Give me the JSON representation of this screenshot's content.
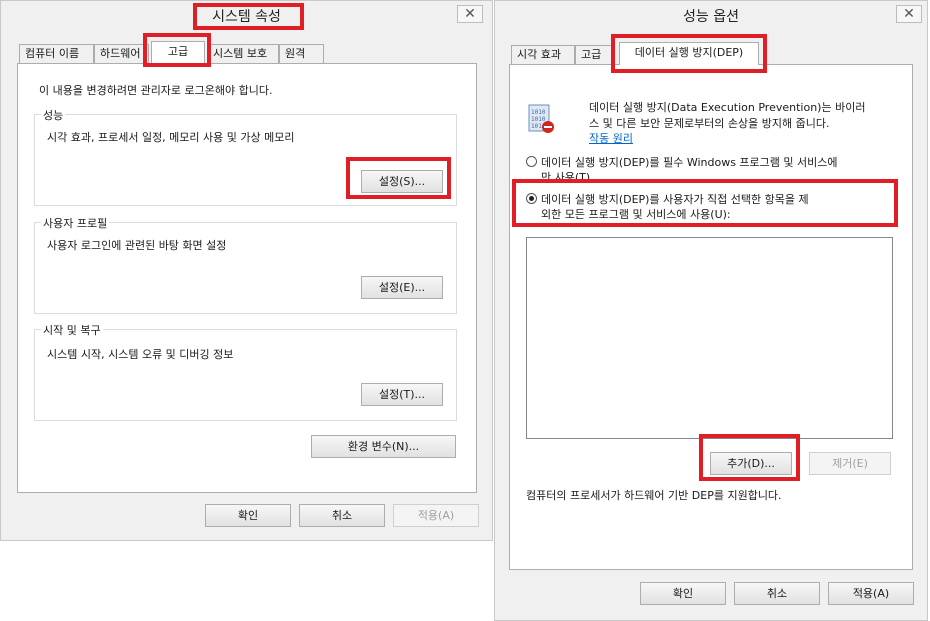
{
  "left_window": {
    "title": "시스템 속성",
    "close_glyph": "✕",
    "tabs": [
      {
        "label": "컴퓨터 이름"
      },
      {
        "label": "하드웨어"
      },
      {
        "label": "고급"
      },
      {
        "label": "시스템 보호"
      },
      {
        "label": "원격"
      }
    ],
    "admin_notice": "이 내용을 변경하려면 관리자로 로그온해야 합니다.",
    "performance": {
      "label": "성능",
      "description": "시각 효과, 프로세서 일정, 메모리 사용 및 가상 메모리",
      "button": "설정(S)..."
    },
    "user_profiles": {
      "label": "사용자 프로필",
      "description": "사용자 로그인에 관련된 바탕 화면 설정",
      "button": "설정(E)..."
    },
    "startup_recovery": {
      "label": "시작 및 복구",
      "description": "시스템 시작, 시스템 오류 및 디버깅 정보",
      "button": "설정(T)..."
    },
    "env_button": "환경 변수(N)...",
    "ok_button": "확인",
    "cancel_button": "취소",
    "apply_button": "적용(A)"
  },
  "right_window": {
    "title": "성능 옵션",
    "close_glyph": "✕",
    "tabs": [
      {
        "label": "시각 효과"
      },
      {
        "label": "고급"
      },
      {
        "label": "데이터 실행 방지(DEP)"
      }
    ],
    "dep_description_line1": "데이터 실행 방지(Data Execution Prevention)는 바이러",
    "dep_description_line2": "스 및 다른 보안 문제로부터의 손상을 방지해 줍니다.",
    "how_it_works_link": "작동 원리",
    "icon_text": "1010",
    "radio_option1_line1": "데이터 실행 방지(DEP)를 필수 Windows 프로그램 및 서비스에",
    "radio_option1_line2": "만 사용(T)",
    "radio_option2_line1": "데이터 실행 방지(DEP)를 사용자가 직접 선택한 항목을 제",
    "radio_option2_line2": "외한 모든 프로그램 및 서비스에 사용(U):",
    "add_button": "추가(D)...",
    "remove_button": "제거(E)",
    "hardware_dep_note": "컴퓨터의 프로세서가 하드웨어 기반 DEP를 지원합니다.",
    "ok_button": "확인",
    "cancel_button": "취소",
    "apply_button": "적용(A)"
  },
  "colors": {
    "highlight": "#e01e26",
    "link": "#0066cc"
  }
}
